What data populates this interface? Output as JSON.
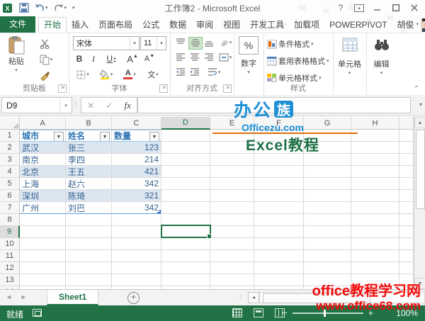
{
  "window": {
    "title": "工作簿2 - Microsoft Excel",
    "controls": {
      "help": "?",
      "minimize": "—",
      "maximize": "□",
      "close": "✕"
    }
  },
  "icons": {
    "skull": "☠",
    "dropdown": "▾",
    "up_arrow": "▲",
    "down_arrow": "▼",
    "left_arrow": "◄",
    "right_arrow": "►",
    "collapse": "⌃",
    "dots": "⋮"
  },
  "tabs": {
    "items": [
      "文件",
      "开始",
      "插入",
      "页面布局",
      "公式",
      "数据",
      "审阅",
      "视图",
      "开发工具",
      "加载项",
      "POWERPIVOT"
    ],
    "active": "开始",
    "user": "胡俊"
  },
  "ribbon": {
    "clipboard": {
      "label": "剪贴板",
      "paste": "粘贴"
    },
    "font": {
      "label": "字体",
      "family": "宋体",
      "size": "11",
      "bold": "B",
      "italic": "I",
      "underline": "U",
      "grow": "A",
      "shrink": "A",
      "color_letter": "A",
      "phonetic": "文"
    },
    "alignment": {
      "label": "对齐方式"
    },
    "number": {
      "label": "数字",
      "percent": "%"
    },
    "styles": {
      "label": "样式",
      "conditional": "条件格式",
      "format_table": "套用表格格式",
      "cell_styles": "单元格样式"
    },
    "cells": {
      "label": "单元格"
    },
    "editing": {
      "label": "编辑"
    }
  },
  "formula_bar": {
    "name_box": "D9",
    "cancel": "✕",
    "enter": "✓",
    "fx": "fx",
    "value": ""
  },
  "grid": {
    "columns": [
      "A",
      "B",
      "C",
      "D",
      "E",
      "F",
      "G",
      "H"
    ],
    "row_count": 14,
    "selected_cell": "D9",
    "selected_column": "D",
    "selected_row": 9
  },
  "table": {
    "headers": [
      "城市",
      "姓名",
      "数量"
    ],
    "rows": [
      [
        "武汉",
        "张三",
        123
      ],
      [
        "南京",
        "李四",
        214
      ],
      [
        "北京",
        "王五",
        421
      ],
      [
        "上海",
        "赵六",
        342
      ],
      [
        "深圳",
        "陈琦",
        321
      ],
      [
        "广州",
        "刘巴",
        342
      ]
    ]
  },
  "sheet_bar": {
    "active_tab": "Sheet1",
    "add": "+"
  },
  "status_bar": {
    "ready": "就绪",
    "zoom_level": "100%"
  },
  "watermarks": {
    "center": {
      "brand_left": "办公",
      "brand_right": "族",
      "site": "Officezu.com",
      "tagline": "Excel教程"
    },
    "corner": {
      "line1": "office教程学习网",
      "line2": "www.office68.com"
    }
  },
  "colors": {
    "excel_green": "#217346",
    "table_band": "#dce6f1",
    "table_header_text": "#2e74b5",
    "table_text": "#35618f",
    "selection_green": "#217346",
    "watermark_blue": "#1e8fd5",
    "watermark_green": "#1e7145",
    "watermark_orange": "#e36c09",
    "watermark_red": "#f40b0b"
  }
}
